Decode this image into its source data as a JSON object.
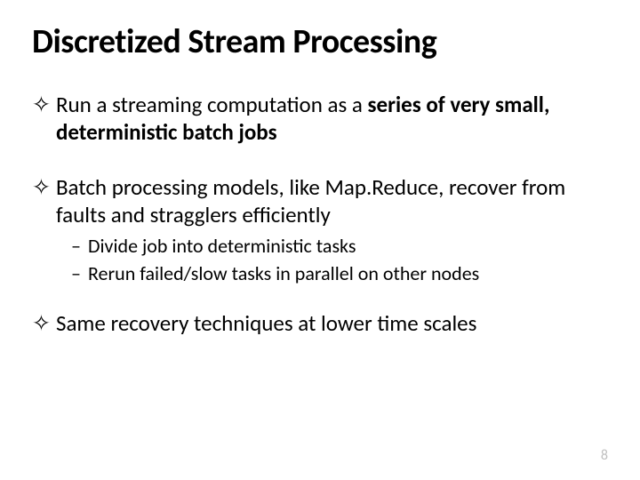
{
  "title": "Discretized Stream Processing",
  "bullets": [
    {
      "pre": "Run a streaming computation as a ",
      "bold": "series of very small, deterministic batch jobs",
      "post": ""
    },
    {
      "pre": "Batch processing models, like Map.Reduce, recover from faults and stragglers efficiently",
      "bold": "",
      "post": "",
      "sub": [
        "Divide job into deterministic tasks",
        "Rerun failed/slow tasks in parallel on other nodes"
      ]
    },
    {
      "pre": "Same recovery techniques at lower time scales",
      "bold": "",
      "post": ""
    }
  ],
  "marker_l1": "✧",
  "marker_l2": "–",
  "page_number": "8"
}
